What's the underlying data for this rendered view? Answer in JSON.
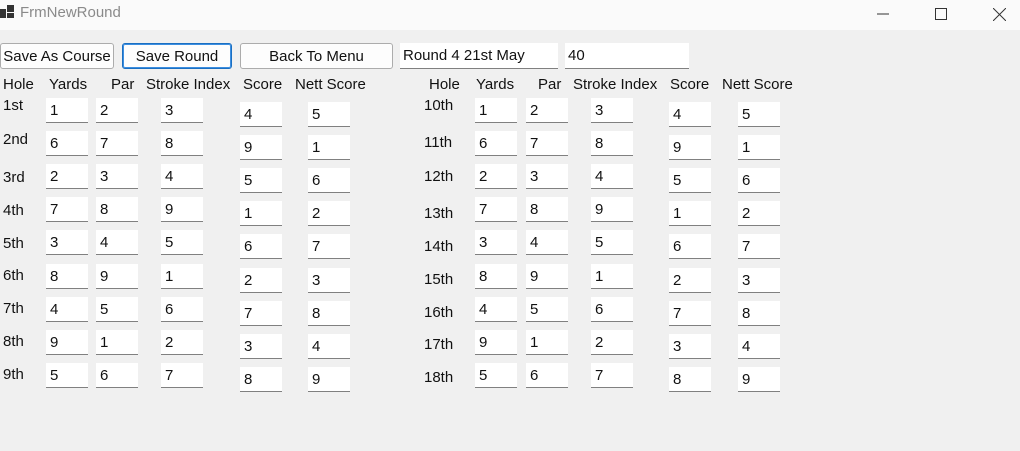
{
  "window": {
    "title": "FrmNewRound",
    "minimize_glyph": "—",
    "maximize_glyph": "☐",
    "close_glyph": "✕"
  },
  "toolbar": {
    "save_as_course_label": "Save As Course",
    "save_round_label": "Save Round",
    "back_to_menu_label": "Back To Menu",
    "round_name_value": "Round 4 21st May",
    "total_value": "40"
  },
  "headers": [
    "Hole",
    "Yards",
    "Par",
    "Stroke Index",
    "Score",
    "Nett Score"
  ],
  "front_nine": [
    {
      "hole": "1st",
      "yards": "1",
      "par": "2",
      "stroke_index": "3",
      "score": "4",
      "nett": "5"
    },
    {
      "hole": "2nd",
      "yards": "6",
      "par": "7",
      "stroke_index": "8",
      "score": "9",
      "nett": "1"
    },
    {
      "hole": "3rd",
      "yards": "2",
      "par": "3",
      "stroke_index": "4",
      "score": "5",
      "nett": "6"
    },
    {
      "hole": "4th",
      "yards": "7",
      "par": "8",
      "stroke_index": "9",
      "score": "1",
      "nett": "2"
    },
    {
      "hole": "5th",
      "yards": "3",
      "par": "4",
      "stroke_index": "5",
      "score": "6",
      "nett": "7"
    },
    {
      "hole": "6th",
      "yards": "8",
      "par": "9",
      "stroke_index": "1",
      "score": "2",
      "nett": "3"
    },
    {
      "hole": "7th",
      "yards": "4",
      "par": "5",
      "stroke_index": "6",
      "score": "7",
      "nett": "8"
    },
    {
      "hole": "8th",
      "yards": "9",
      "par": "1",
      "stroke_index": "2",
      "score": "3",
      "nett": "4"
    },
    {
      "hole": "9th",
      "yards": "5",
      "par": "6",
      "stroke_index": "7",
      "score": "8",
      "nett": "9"
    }
  ],
  "back_nine": [
    {
      "hole": "10th",
      "yards": "1",
      "par": "2",
      "stroke_index": "3",
      "score": "4",
      "nett": "5"
    },
    {
      "hole": "11th",
      "yards": "6",
      "par": "7",
      "stroke_index": "8",
      "score": "9",
      "nett": "1"
    },
    {
      "hole": "12th",
      "yards": "2",
      "par": "3",
      "stroke_index": "4",
      "score": "5",
      "nett": "6"
    },
    {
      "hole": "13th",
      "yards": "7",
      "par": "8",
      "stroke_index": "9",
      "score": "1",
      "nett": "2"
    },
    {
      "hole": "14th",
      "yards": "3",
      "par": "4",
      "stroke_index": "5",
      "score": "6",
      "nett": "7"
    },
    {
      "hole": "15th",
      "yards": "8",
      "par": "9",
      "stroke_index": "1",
      "score": "2",
      "nett": "3"
    },
    {
      "hole": "16th",
      "yards": "4",
      "par": "5",
      "stroke_index": "6",
      "score": "7",
      "nett": "8"
    },
    {
      "hole": "17th",
      "yards": "9",
      "par": "1",
      "stroke_index": "2",
      "score": "3",
      "nett": "4"
    },
    {
      "hole": "18th",
      "yards": "5",
      "par": "6",
      "stroke_index": "7",
      "score": "8",
      "nett": "9"
    }
  ]
}
